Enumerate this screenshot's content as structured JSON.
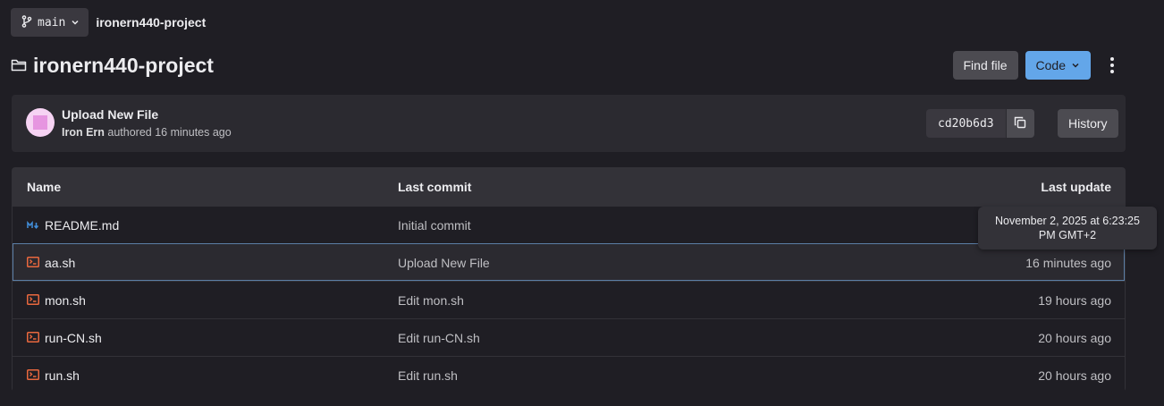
{
  "header": {
    "branch_label": "main",
    "breadcrumb_project": "ironern440-project",
    "page_title": "ironern440-project",
    "find_file_label": "Find file",
    "code_label": "Code"
  },
  "commit": {
    "title": "Upload New File",
    "author": "Iron Ern",
    "authored_text": "authored 16 minutes ago",
    "sha": "cd20b6d3",
    "history_label": "History"
  },
  "table": {
    "columns": {
      "name": "Name",
      "last_commit": "Last commit",
      "last_update": "Last update"
    },
    "rows": [
      {
        "name": "README.md",
        "icon": "markdown-icon",
        "last_commit": "Initial commit",
        "last_update": ""
      },
      {
        "name": "aa.sh",
        "icon": "terminal-file-icon",
        "last_commit": "Upload New File",
        "last_update": "16 minutes ago"
      },
      {
        "name": "mon.sh",
        "icon": "terminal-file-icon",
        "last_commit": "Edit mon.sh",
        "last_update": "19 hours ago"
      },
      {
        "name": "run-CN.sh",
        "icon": "terminal-file-icon",
        "last_commit": "Edit run-CN.sh",
        "last_update": "20 hours ago"
      },
      {
        "name": "run.sh",
        "icon": "terminal-file-icon",
        "last_commit": "Edit run.sh",
        "last_update": "20 hours ago"
      }
    ]
  },
  "tooltip": {
    "text": "November 2, 2025 at 6:23:25 PM GMT+2"
  },
  "colors": {
    "accent": "#63a6e9",
    "file_icon": "#e9683e",
    "markdown_icon": "#428fdc"
  }
}
